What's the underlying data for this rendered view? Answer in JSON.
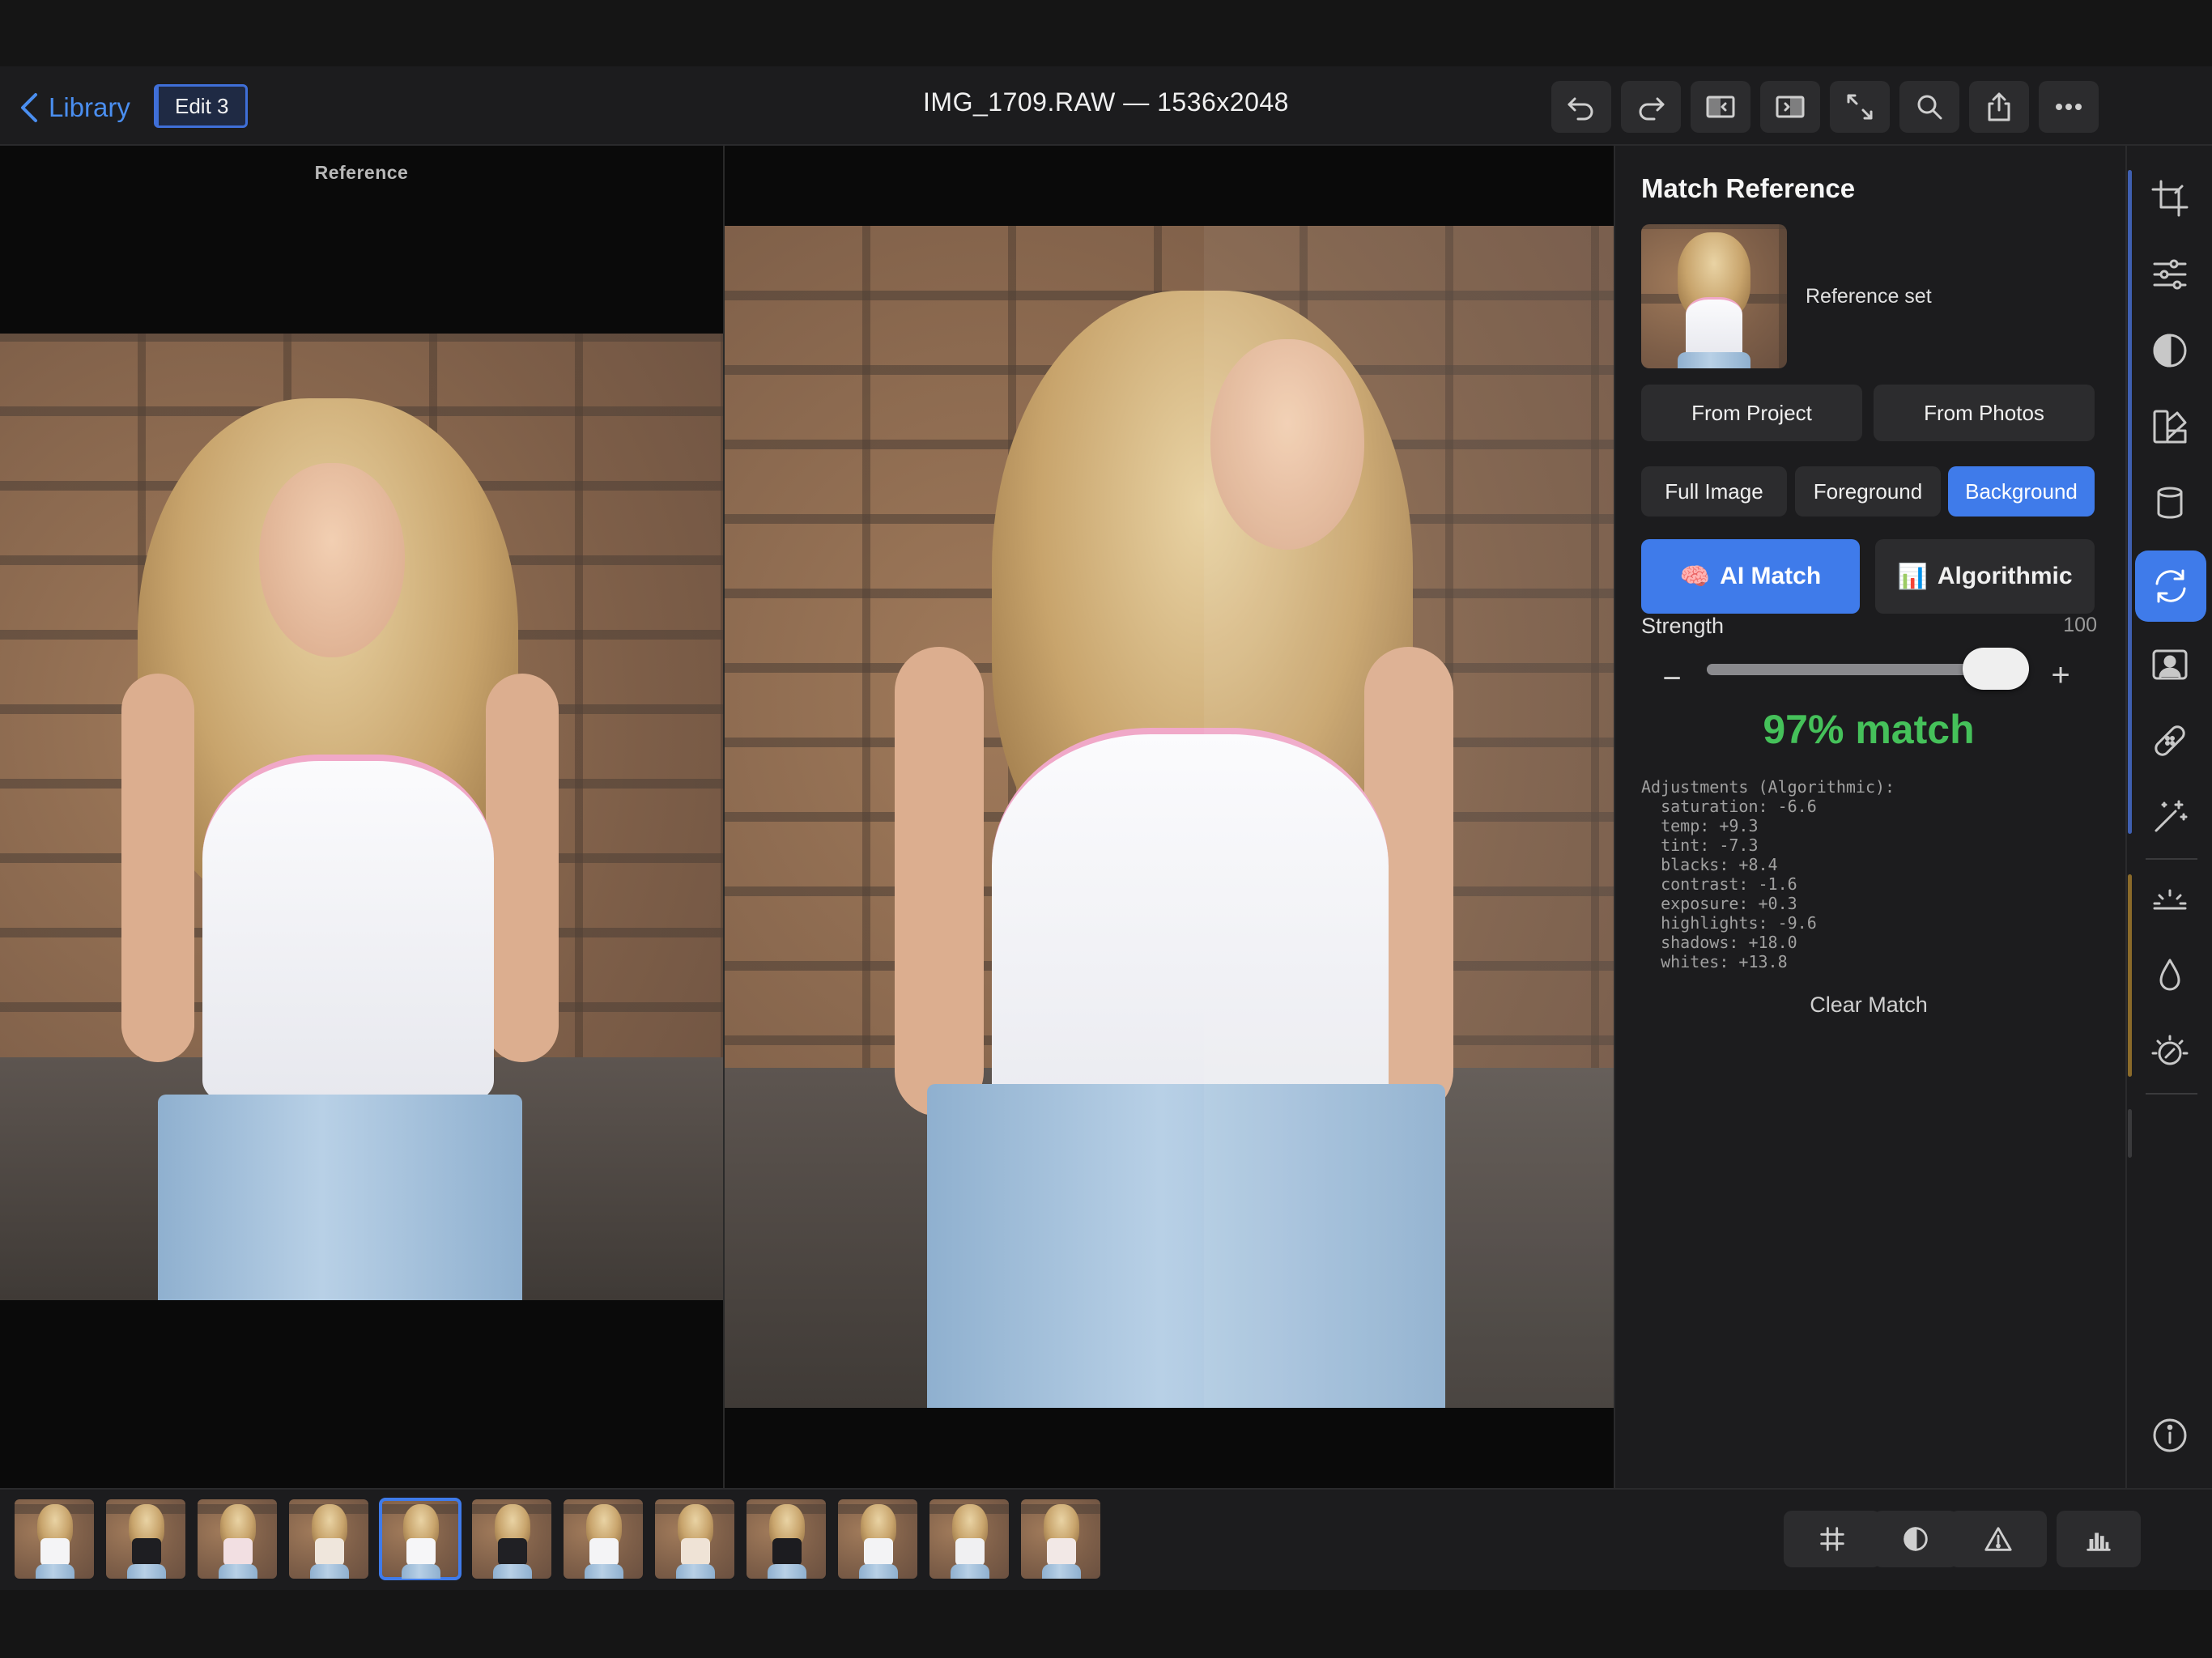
{
  "header": {
    "back_label": "Library",
    "edit_badge": "Edit 3",
    "title": "IMG_1709.RAW — 1536x2048",
    "toolbar_icons": [
      "undo-icon",
      "redo-icon",
      "compare-left-icon",
      "compare-right-icon",
      "expand-icon",
      "search-icon",
      "share-icon",
      "more-icon"
    ]
  },
  "canvas": {
    "reference_label": "Reference"
  },
  "panel": {
    "title": "Match Reference",
    "reference_set": "Reference set",
    "source_buttons": [
      "From Project",
      "From Photos"
    ],
    "regions": [
      {
        "label": "Full Image",
        "selected": false
      },
      {
        "label": "Foreground",
        "selected": false
      },
      {
        "label": "Background",
        "selected": true
      }
    ],
    "modes": [
      {
        "label": "AI Match",
        "icon": "🧠",
        "selected": true
      },
      {
        "label": "Algorithmic",
        "icon": "📊",
        "selected": false
      }
    ],
    "strength_label": "Strength",
    "strength_value": "100",
    "strength": 100,
    "minus": "−",
    "plus": "+",
    "match_text": "97% match",
    "adjustments_text": "Adjustments (Algorithmic):\n  saturation: -6.6\n  temp: +9.3\n  tint: -7.3\n  blacks: +8.4\n  contrast: -1.6\n  exposure: +0.3\n  highlights: -9.6\n  shadows: +18.0\n  whites: +13.8",
    "clear_label": "Clear Match"
  },
  "rail": {
    "icons": [
      "crop-icon",
      "sliders-icon",
      "tone-icon",
      "color-mix-icon",
      "cylinder-icon",
      "match-sync-icon",
      "portrait-icon",
      "bandage-icon",
      "magic-wand-icon",
      "light-icon",
      "drop-icon",
      "detail-icon",
      "info-icon"
    ],
    "active": "match-sync-icon"
  },
  "filmstrip": {
    "count": 12,
    "selected_index": 4,
    "tools": [
      "grid-icon",
      "contrast-icon",
      "warning-icon",
      "histogram-icon"
    ]
  },
  "colors": {
    "accent": "#3f7bea",
    "link": "#4a8ef0",
    "match_green": "#45c15a"
  }
}
